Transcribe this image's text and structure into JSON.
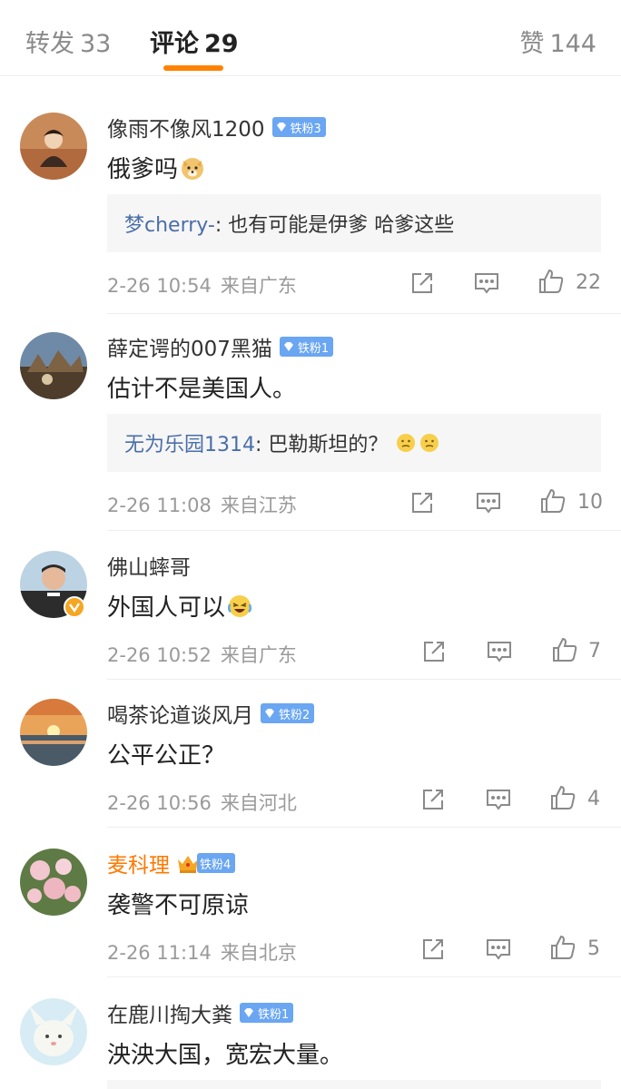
{
  "tabs": {
    "repost": {
      "label": "转发",
      "count": "33"
    },
    "comments": {
      "label": "评论",
      "count": "29"
    },
    "likes": {
      "label": "赞",
      "count": "144"
    }
  },
  "accent_color": "#ff8200",
  "reply_name_color": "#4a6ea9",
  "fan_badge_color": "#6aa6f2",
  "comments": [
    {
      "username": "像雨不像风1200",
      "fan_badge": "铁粉3",
      "text": "俄爹吗",
      "emoji": "doge-emoji",
      "reply": {
        "name": "梦cherry-",
        "text": ": 也有可能是伊爹 哈爹这些"
      },
      "time": "2-26 10:54",
      "location": "来自广东",
      "likes": "22"
    },
    {
      "username": "薛定谔的007黑猫",
      "fan_badge": "铁粉1",
      "text": "估计不是美国人。",
      "reply": {
        "name": "无为乐园1314",
        "text": ": 巴勒斯坦的？"
      },
      "time": "2-26 11:08",
      "location": "来自江苏",
      "likes": "10"
    },
    {
      "username": "佛山蟀哥",
      "verified": true,
      "text": "外国人可以",
      "emoji": "laugh-cry-emoji",
      "time": "2-26 10:52",
      "location": "来自广东",
      "likes": "7"
    },
    {
      "username": "喝茶论道谈风月",
      "fan_badge": "铁粉2",
      "text": "公平公正？",
      "time": "2-26 10:56",
      "location": "来自河北",
      "likes": "4"
    },
    {
      "username": "麦科理",
      "username_color": "#ff7800",
      "fan_badge": "铁粉4",
      "crown": true,
      "text": "袭警不可原谅",
      "time": "2-26 11:14",
      "location": "来自北京",
      "likes": "5"
    },
    {
      "username": "在鹿川掏大粪",
      "fan_badge": "铁粉1",
      "text": "泱泱大国，宽宏大量。"
    }
  ]
}
